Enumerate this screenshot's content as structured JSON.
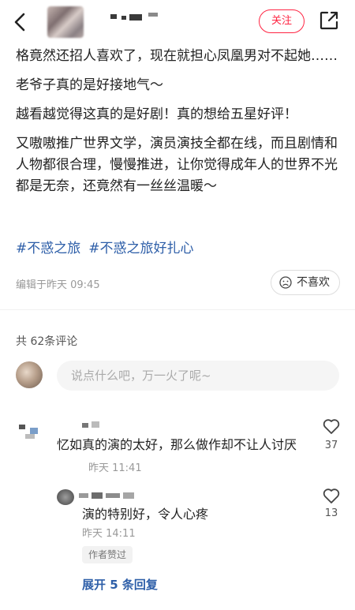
{
  "header": {
    "follow_label": "关注"
  },
  "post": {
    "paragraphs": [
      "格竟然还招人喜欢了，现在就担心凤凰男对不起她……",
      "老爷子真的是好接地气～",
      "越看越觉得这真的是好剧！真的想给五星好评！",
      "又嗷嗷推广世界文学，演员演技全都在线，而且剧情和人物都很合理，慢慢推进，让你觉得成年人的世界不光都是无奈，还竟然有一丝丝温暖～"
    ],
    "tags": [
      "#不惑之旅",
      "#不惑之旅好扎心"
    ],
    "edit_time": "编辑于昨天 09:45",
    "dislike_label": "不喜欢"
  },
  "comments_section": {
    "count_label": "共 62条评论",
    "input_placeholder": "说点什么吧，万一火了呢~",
    "comment": {
      "text": "忆如真的演的太好，那么做作却不让人讨厌",
      "time": "昨天 11:41",
      "like_count": "37"
    },
    "reply": {
      "text": "演的特别好，令人心疼",
      "time": "昨天 14:11",
      "like_count": "13",
      "author_liked": "作者赞过"
    },
    "expand_label": "展开 5 条回复"
  },
  "icons": {
    "back": "chevron-left-icon",
    "share": "share-icon",
    "dislike": "sad-face-icon",
    "like": "heart-icon"
  },
  "colors": {
    "accent_red": "#ff2442",
    "link_blue": "#2d5ea8"
  }
}
